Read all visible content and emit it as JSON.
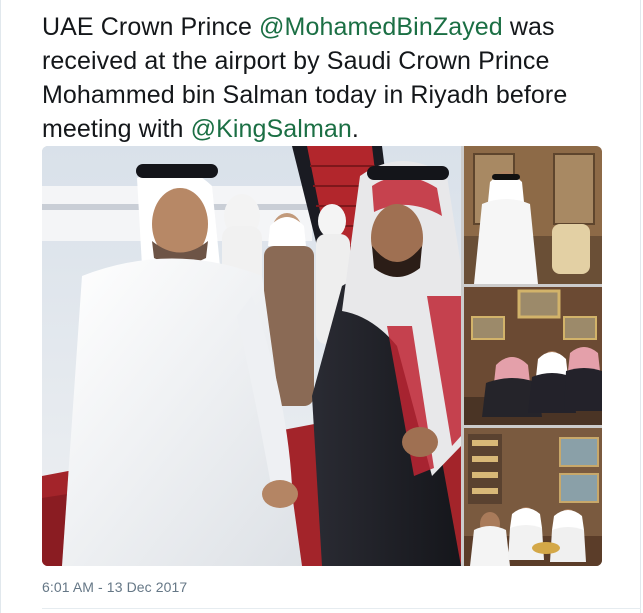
{
  "tweet": {
    "segments": [
      {
        "text": "UAE Crown Prince ",
        "type": "text"
      },
      {
        "text": "@MohamedBinZayed",
        "type": "mention"
      },
      {
        "text": " was received at the airport by Saudi Crown Prince Mohammed bin Salman today in Riyadh before meeting with ",
        "type": "text"
      },
      {
        "text": "@KingSalman",
        "type": "mention"
      },
      {
        "text": ".",
        "type": "text"
      }
    ]
  },
  "media": {
    "photo_count": 4
  },
  "timestamp": "6:01 AM - 13 Dec 2017",
  "colors": {
    "mention": "#1b6f44",
    "text": "#14171a",
    "meta": "#657786",
    "carpet": "#a3242a"
  }
}
